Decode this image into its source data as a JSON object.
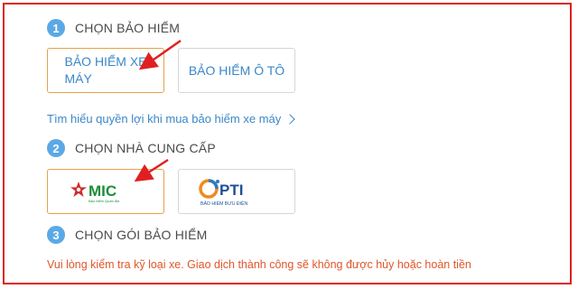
{
  "steps": [
    {
      "number": "1",
      "label": "CHỌN BẢO HIỂM"
    },
    {
      "number": "2",
      "label": "CHỌN NHÀ CUNG CẤP"
    },
    {
      "number": "3",
      "label": "CHỌN GÓI BẢO HIỂM"
    }
  ],
  "insurance_options": [
    {
      "line1": "BẢO HIỂM XE",
      "line2": "MÁY",
      "selected": true
    },
    {
      "label": "BẢO HIỂM Ô TÔ",
      "selected": false
    }
  ],
  "benefits_link": "Tìm hiểu quyền lợi khi mua bảo hiểm xe máy",
  "providers": [
    {
      "name": "MIC",
      "tagline": "Bảo hiểm Quân đội",
      "selected": true
    },
    {
      "name": "PTI",
      "tagline": "BẢO HIỂM BƯU ĐIỆN",
      "selected": false
    }
  ],
  "warning": "Vui lòng kiểm tra kỹ loại xe. Giao dịch thành công sẽ không được hủy hoặc hoàn tiền",
  "colors": {
    "accent": "#3b87c7",
    "step_badge": "#5aa9e6",
    "selected_border": "#e5a14a",
    "annotation": "#e02020",
    "warning": "#e0562a"
  }
}
